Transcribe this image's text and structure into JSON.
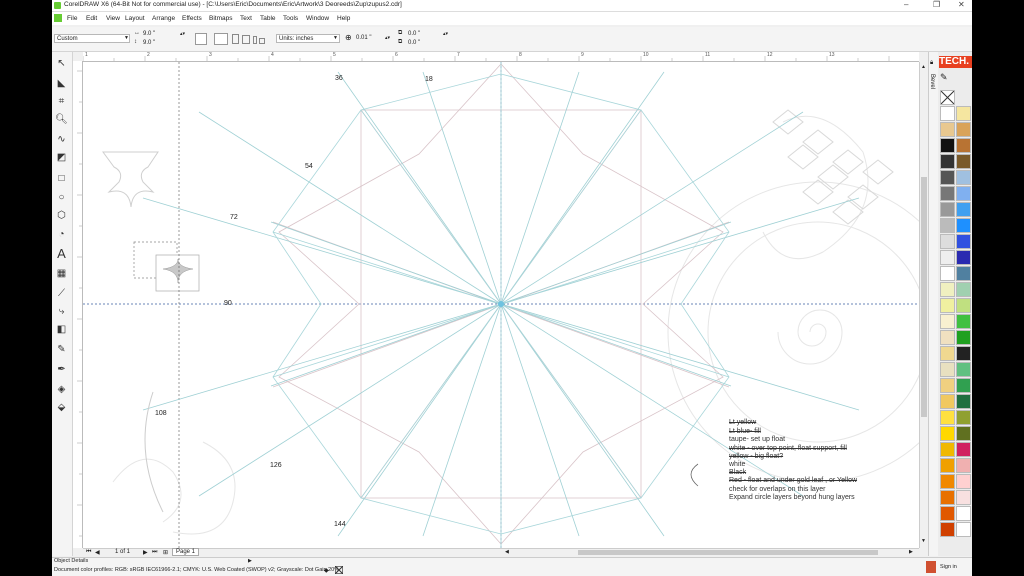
{
  "window": {
    "title": "CorelDRAW X6 (64-Bit Not for commercial use) - [C:\\Users\\Eric\\Documents\\Eric\\Artwork\\3 Deoreeds\\Zup\\zupus2.cdr]",
    "minimize": "–",
    "maximize": "❐",
    "close": "✕"
  },
  "menu": [
    "File",
    "Edit",
    "View",
    "Layout",
    "Arrange",
    "Effects",
    "Bitmaps",
    "Text",
    "Table",
    "Tools",
    "Window",
    "Help"
  ],
  "propbar": {
    "preset": "Custom",
    "width": "9.0 \"",
    "height": "9.0 \"",
    "units_label": "Units: inches",
    "nudge": "0.01 \"",
    "dup_x": "0.0 \"",
    "dup_y": "0.0 \""
  },
  "ruler": {
    "h_ticks": [
      "1",
      "2",
      "3",
      "4",
      "5",
      "6",
      "7",
      "8",
      "9",
      "10",
      "11",
      "12",
      "13"
    ]
  },
  "canvas_labels": {
    "l36": "36",
    "l18": "18",
    "l54": "54",
    "l72": "72",
    "l90": "90",
    "l108": "108",
    "l126": "126",
    "l144": "144"
  },
  "notes": [
    "Lt yellow",
    "Lt blue- fill",
    "taupe- set up float",
    "white - over top point, float support, fill",
    "yellow - big float?",
    "white",
    "Black",
    "Red - float and under gold leaf , or Yellow",
    "check for overlaps on this layer",
    "Expand circle layers beyond hung layers"
  ],
  "page_nav": {
    "count": "1 of 1",
    "tab": "Page 1"
  },
  "status": {
    "object_details": "Object Details",
    "color_profile": "Document color profiles: RGB: sRGB IEC61966-2.1; CMYK: U.S. Web Coated (SWOP) v2; Grayscale: Dot Gain 20%"
  },
  "docker_tab": "Bevel",
  "watermark": "TECH.",
  "sign_in": "Sign in",
  "palette_colors": [
    [
      "#ffffff",
      "#f5e6a0"
    ],
    [
      "#e8c890",
      "#d9a35a"
    ],
    [
      "#111111",
      "#b87333"
    ],
    [
      "#333333",
      "#7a5a2a"
    ],
    [
      "#555555",
      "#a0c0e0"
    ],
    [
      "#777777",
      "#80b0f0"
    ],
    [
      "#999999",
      "#40a0f0"
    ],
    [
      "#bbbbbb",
      "#1e90ff"
    ],
    [
      "#dddddd",
      "#3050e0"
    ],
    [
      "#eeeeee",
      "#2a2ab0"
    ],
    [
      "#ffffff",
      "#5080a0"
    ],
    [
      "#f0f0c0",
      "#a0d0b0"
    ],
    [
      "#f0f0a0",
      "#c0e080"
    ],
    [
      "#f8f0d0",
      "#40c040"
    ],
    [
      "#f0e0c0",
      "#20a020"
    ],
    [
      "#f0d890",
      "#222222"
    ],
    [
      "#e8e0c0",
      "#60c080"
    ],
    [
      "#f0d080",
      "#30a050"
    ],
    [
      "#f0c860",
      "#1f6f3f"
    ],
    [
      "#ffe040",
      "#90a030"
    ],
    [
      "#ffd800",
      "#607020"
    ],
    [
      "#f0b800",
      "#d02060"
    ],
    [
      "#f0a000",
      "#f0b0b0"
    ],
    [
      "#f08800",
      "#ffd0d0"
    ],
    [
      "#e87000",
      "#f8e0e0"
    ],
    [
      "#e05800",
      "#ffffff"
    ],
    [
      "#d04000",
      "#ffffff"
    ]
  ]
}
